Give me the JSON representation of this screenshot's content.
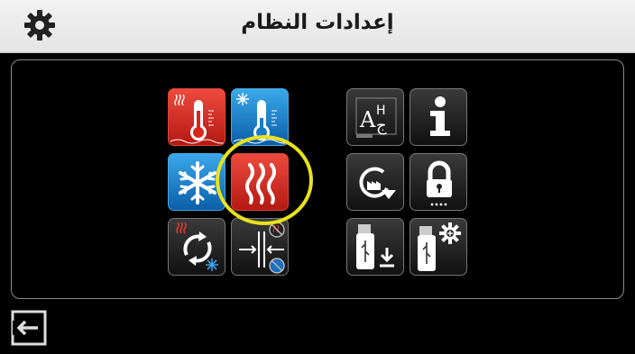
{
  "header": {
    "title": "إعدادات النظام",
    "icon": "gear-icon"
  },
  "tiles": [
    {
      "name": "heating-setpoint-tile",
      "icon": "thermometer-hot-icon",
      "color": "#d8261c"
    },
    {
      "name": "cooling-setpoint-tile",
      "icon": "thermometer-cold-icon",
      "color": "#1a7cc8"
    },
    {
      "name": "cooling-mode-tile",
      "icon": "snowflake-icon",
      "color": "#1a7cc8"
    },
    {
      "name": "heating-mode-tile",
      "icon": "heat-waves-icon",
      "color": "#d8261c",
      "highlighted": true
    },
    {
      "name": "auto-changeover-tile",
      "icon": "heat-cool-cycle-icon"
    },
    {
      "name": "deadband-tile",
      "icon": "deadband-icon"
    },
    {
      "name": "language-tile",
      "icon": "language-icon"
    },
    {
      "name": "info-tile",
      "icon": "info-icon"
    },
    {
      "name": "factory-reset-tile",
      "icon": "factory-reset-icon"
    },
    {
      "name": "lock-tile",
      "icon": "lock-icon"
    },
    {
      "name": "usb-import-tile",
      "icon": "usb-download-icon"
    },
    {
      "name": "usb-settings-tile",
      "icon": "usb-settings-icon"
    }
  ],
  "language_icon_text": {
    "latin": "A",
    "arabic": "ج",
    "small": "H"
  },
  "highlight_color": "#e8e11d",
  "footer": {
    "icon": "exit-icon"
  }
}
